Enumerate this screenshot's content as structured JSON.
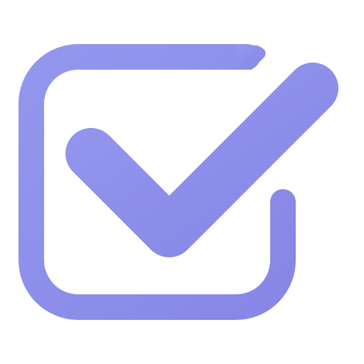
{
  "icon": {
    "name": "checkbox-checked-icon",
    "colors": {
      "gradient_start": "#9497ee",
      "gradient_end": "#8786e6",
      "background": "#ffffff"
    }
  }
}
